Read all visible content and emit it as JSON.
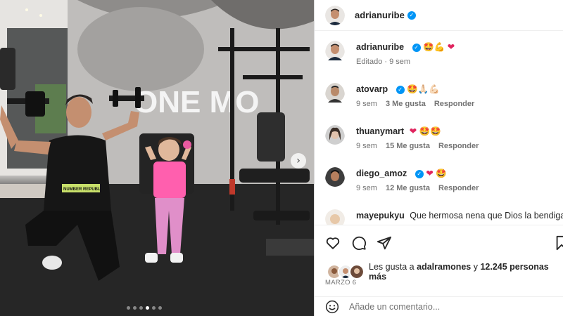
{
  "post": {
    "author": "adrianuribe",
    "caption_emojis": "🤩💪",
    "edited_label": "Editado",
    "caption_time": "9 sem",
    "dot_separator": "·",
    "carousel": {
      "total": 6,
      "active_index": 3
    },
    "photo": {
      "mural_text": "ONE MO",
      "shirt_text": "NUMBER REPUBLIC"
    }
  },
  "comments": [
    {
      "user": "atovarp",
      "verified": true,
      "text": "🤩🙏🏻💪🏻",
      "hearts": "",
      "time": "9 sem",
      "likes": "3 Me gusta",
      "reply": "Responder"
    },
    {
      "user": "thuanymart",
      "verified": false,
      "text": "🤩🤩",
      "hearts": "❤",
      "time": "9 sem",
      "likes": "15 Me gusta",
      "reply": "Responder"
    },
    {
      "user": "diego_amoz",
      "verified": true,
      "text": "🤩",
      "hearts": "❤",
      "time": "9 sem",
      "likes": "12 Me gusta",
      "reply": "Responder"
    },
    {
      "user": "mayepukyu",
      "verified": false,
      "text": "Que hermosa nena que Dios la bendiga",
      "hearts": "",
      "time": "",
      "likes": "",
      "reply": ""
    }
  ],
  "likes": {
    "prefix": "Les gusta a",
    "user": "adalramones",
    "connector": "y",
    "others": "12.245 personas más"
  },
  "date": "MARZO 6",
  "add_comment": {
    "placeholder": "Añade un comentario..."
  },
  "icons": {
    "like": "heart-outline-icon",
    "comment": "comment-icon",
    "share": "send-icon",
    "save": "bookmark-icon",
    "emoji": "smiley-icon"
  },
  "colors": {
    "verified": "#0095f6",
    "heart": "#e0245e",
    "muted": "#737373"
  }
}
